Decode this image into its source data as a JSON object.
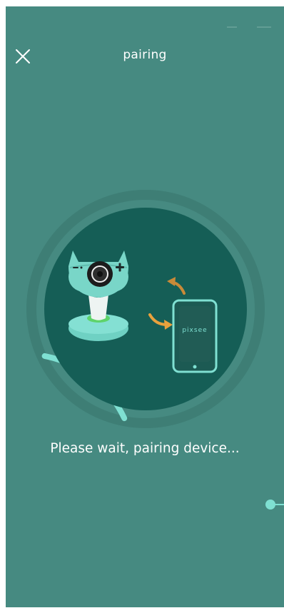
{
  "header": {
    "title": "pairing",
    "close_icon": "close-icon"
  },
  "illustration": {
    "phone_brand": "pixsee",
    "progress": 0.15,
    "icons": [
      "camera-device-icon",
      "phone-icon",
      "sync-arrows-icon"
    ],
    "colors": {
      "background": "#468a81",
      "ring_track": "#3e7e75",
      "ring_progress": "#7fe0d2",
      "inner_circle": "#155e56",
      "accent_arrow": "#e8a13d",
      "phone_outline": "#7fe0d2"
    }
  },
  "status": {
    "message": "Please wait, pairing device..."
  }
}
